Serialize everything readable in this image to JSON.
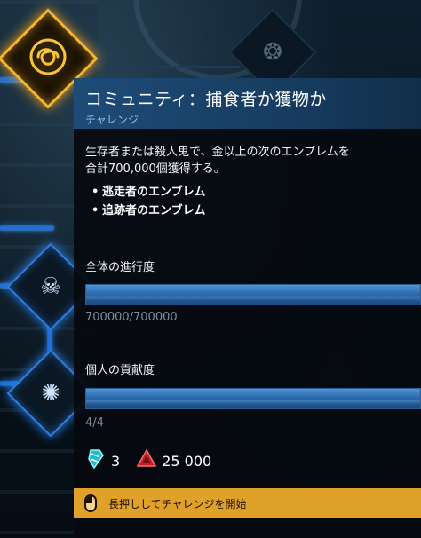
{
  "tooltip": {
    "title": "コミュニティ：捕食者か獲物か",
    "subtitle": "チャレンジ",
    "description": "生存者または殺人鬼で、金以上の次のエンブレムを合計700,000個獲得する。",
    "bullets": [
      "逃走者のエンブレム",
      "追跡者のエンブレム"
    ],
    "global_progress": {
      "label": "全体の進行度",
      "value_text": "700000/700000",
      "fraction": 1.0
    },
    "personal_contribution": {
      "label": "個人の貢献度",
      "value_text": "4/4",
      "fraction": 1.0
    },
    "rewards": [
      {
        "icon": "rift-fragment-icon",
        "amount": "3"
      },
      {
        "icon": "auric-cell-icon",
        "amount": "25 000"
      }
    ],
    "hold_prompt": "長押ししてチャレンジを開始"
  },
  "colors": {
    "accent_blue": "#1f6fd6",
    "header_blue": "#1d4c78",
    "gold": "#f5b52a",
    "prompt_bar": "#e0a12a"
  }
}
